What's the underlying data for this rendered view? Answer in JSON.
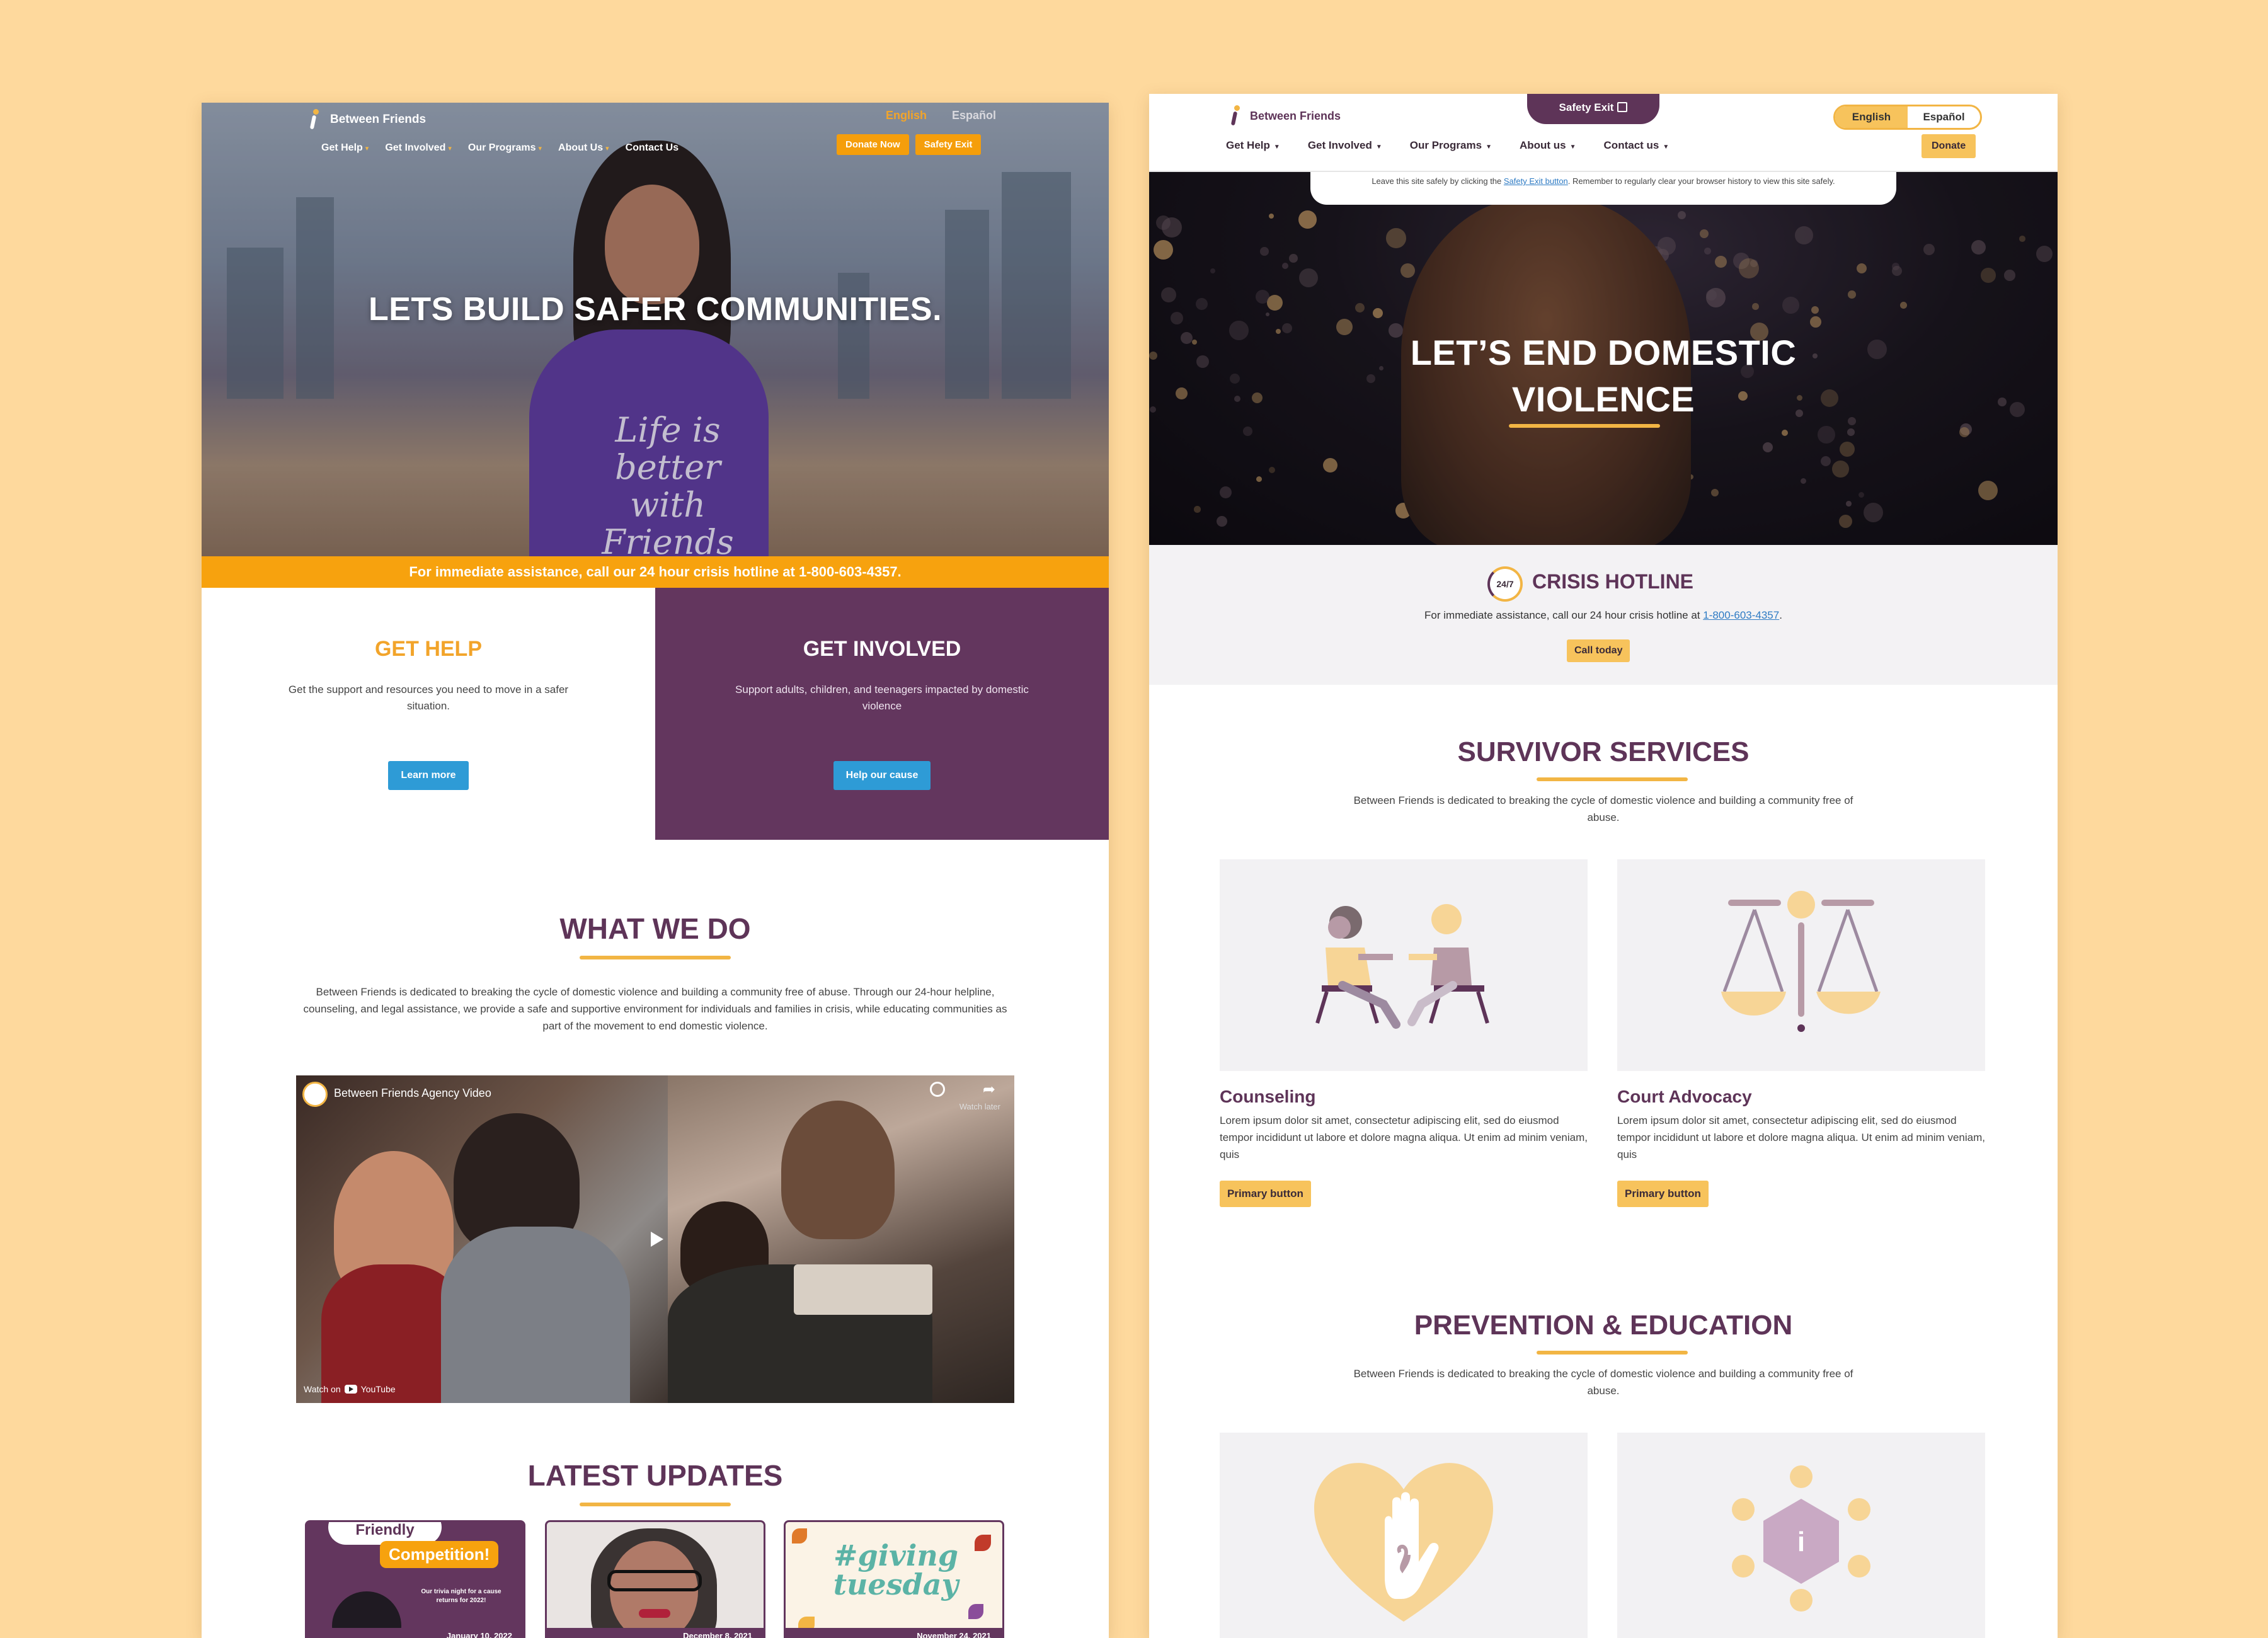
{
  "colors": {
    "background": "#FED99D",
    "purple": "#5E3458",
    "accent_yellow": "#F2B544",
    "orange": "#F7A20E",
    "blue_button": "#2E9BD6"
  },
  "left_page": {
    "logo_text": "Between Friends",
    "lang": {
      "english": "English",
      "espanol": "Español"
    },
    "nav": [
      "Get Help",
      "Get Involved",
      "Our Programs",
      "About Us",
      "Contact Us"
    ],
    "buttons": {
      "donate": "Donate Now",
      "safety_exit": "Safety Exit"
    },
    "hero_title": "LETS BUILD SAFER COMMUNITIES.",
    "hero_shirt_text": "Life is better with Friends",
    "hotline_text": "For immediate assistance, call our 24 hour crisis hotline at 1-800-603-4357.",
    "get_help": {
      "title": "GET HELP",
      "text": "Get the support and resources you need to move in a safer situation.",
      "button": "Learn more"
    },
    "get_involved": {
      "title": "GET INVOLVED",
      "text": "Support adults, children, and teenagers impacted by domestic violence",
      "button": "Help our cause"
    },
    "what_we_do": {
      "title": "WHAT WE DO",
      "text": "Between Friends is dedicated to breaking the cycle of domestic violence and building a community free of abuse. Through our 24-hour helpline, counseling, and legal assistance, we provide a safe and supportive environment for individuals and families in crisis, while educating communities as part of the movement to end domestic violence."
    },
    "video": {
      "title": "Between Friends Agency Video",
      "watch_later": "Watch later",
      "watch_on": "Watch on",
      "youtube": "YouTube"
    },
    "latest_updates": {
      "title": "LATEST UPDATES",
      "items": [
        {
          "date": "January 10, 2022",
          "heading": "Friendly",
          "badge": "Competition!",
          "caption": "Our trivia night for a cause returns for 2022!"
        },
        {
          "date": "December 8, 2021"
        },
        {
          "date": "November 24, 2021",
          "heading": "#giving tuesday"
        }
      ]
    }
  },
  "right_page": {
    "logo_text": "Between Friends",
    "safety_exit": "Safety Exit",
    "lang": {
      "english": "English",
      "espanol": "Español"
    },
    "nav": [
      "Get Help",
      "Get Involved",
      "Our Programs",
      "About us",
      "Contact us"
    ],
    "donate": "Donate",
    "notice": {
      "before": "Leave this site safely by clicking the ",
      "link": "Safety Exit button",
      "after": ". Remember to regularly clear your browser history to view this site safely."
    },
    "hero_title_line1": "LET’S END DOMESTIC",
    "hero_title_line2": "VIOLENCE",
    "crisis": {
      "icon_text": "24/7",
      "title": "CRISIS HOTLINE",
      "text_before": "For immediate assistance, call our 24 hour crisis hotline at ",
      "phone": "1-800-603-4357",
      "text_after": ".",
      "button": "Call today"
    },
    "survivor_services": {
      "title": "SURVIVOR SERVICES",
      "text": "Between Friends is dedicated to breaking the cycle of domestic violence and building a community free of abuse.",
      "cards": [
        {
          "title": "Counseling",
          "text": "Lorem ipsum dolor sit amet, consectetur adipiscing elit, sed do eiusmod tempor incididunt ut labore et dolore magna aliqua. Ut enim ad minim veniam, quis",
          "button": "Primary button"
        },
        {
          "title": "Court Advocacy",
          "text": "Lorem ipsum dolor sit amet, consectetur adipiscing elit, sed do eiusmod tempor incididunt ut labore et dolore magna aliqua. Ut enim ad minim veniam, quis",
          "button": "Primary button"
        }
      ]
    },
    "prevention": {
      "title": "PREVENTION & EDUCATION",
      "text": "Between Friends is dedicated to breaking the cycle of domestic violence and building a community free of abuse.",
      "info_icon_text": "i"
    }
  }
}
